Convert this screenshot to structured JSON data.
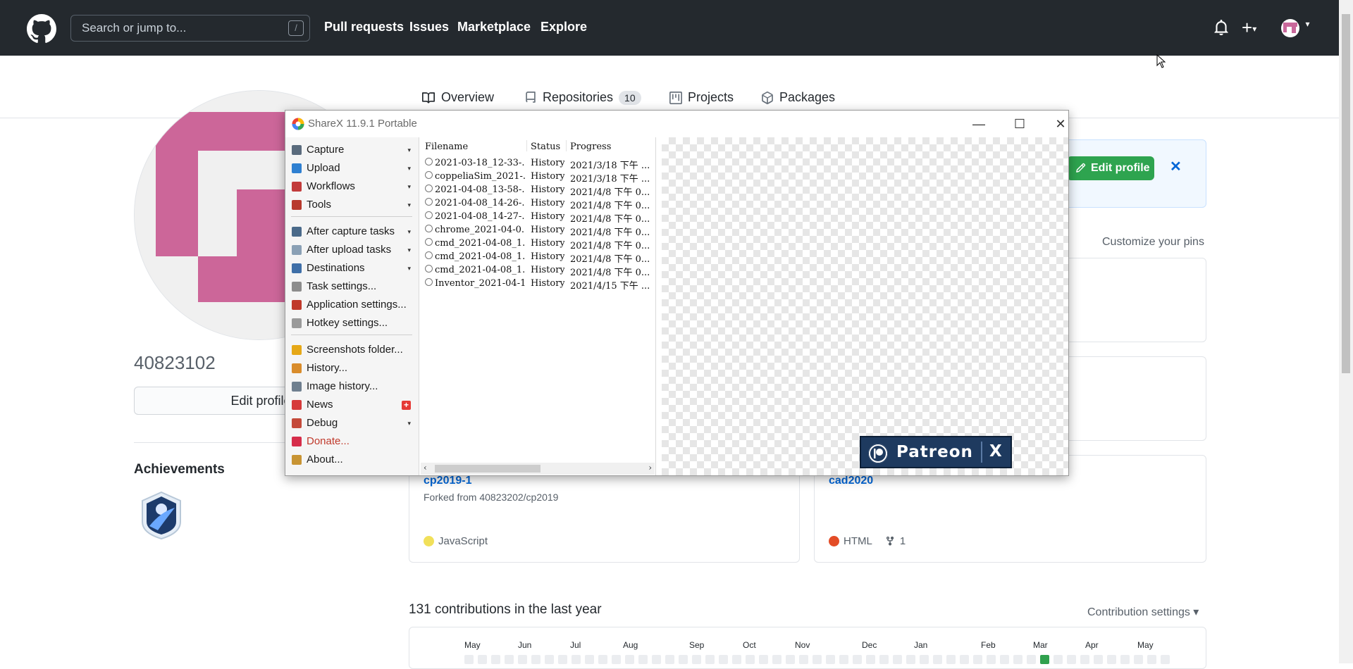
{
  "header": {
    "search_placeholder": "Search or jump to...",
    "search_kbd": "/",
    "nav": [
      "Pull requests",
      "Issues",
      "Marketplace",
      "Explore"
    ],
    "plus": "+"
  },
  "tabs": [
    {
      "label": "Overview"
    },
    {
      "label": "Repositories",
      "count": "10"
    },
    {
      "label": "Projects"
    },
    {
      "label": "Packages"
    }
  ],
  "profile": {
    "username": "40823102",
    "edit_button": "Edit profile",
    "achievements_title": "Achievements"
  },
  "notice": {
    "edit_button": "Edit profile",
    "close": "✕"
  },
  "pins": {
    "customize": "Customize your pins",
    "cards": [
      {
        "name": "cp2019-1",
        "forked": "Forked from 40823202/cp2019",
        "language": "JavaScript",
        "lang_color": "#f1e05a"
      },
      {
        "name": "cad2020",
        "language": "HTML",
        "lang_color": "#e34c26",
        "forks": "1"
      }
    ]
  },
  "contributions": {
    "title": "131 contributions in the last year",
    "settings": "Contribution settings ▾",
    "months": [
      "May",
      "Jun",
      "Jul",
      "Aug",
      "Sep",
      "Oct",
      "Nov",
      "Dec",
      "Jan",
      "Feb",
      "Mar",
      "Apr",
      "May"
    ],
    "active_color": "#30a14e"
  },
  "sharex": {
    "title": "ShareX 11.9.1 Portable",
    "controls": {
      "minimize": "—",
      "maximize": "☐",
      "close": "✕"
    },
    "menu": [
      {
        "label": "Capture",
        "submenu": true,
        "icon_color": "#5a6b7d"
      },
      {
        "label": "Upload",
        "submenu": true,
        "icon_color": "#2f80d1"
      },
      {
        "label": "Workflows",
        "submenu": true,
        "icon_color": "#c23b3b"
      },
      {
        "label": "Tools",
        "submenu": true,
        "icon_color": "#b83a2d"
      },
      {
        "label": "After capture tasks",
        "submenu": true,
        "icon_color": "#4a6a8a"
      },
      {
        "label": "After upload tasks",
        "submenu": true,
        "icon_color": "#8aa0b5"
      },
      {
        "label": "Destinations",
        "submenu": true,
        "icon_color": "#3f6fa8"
      },
      {
        "label": "Task settings...",
        "submenu": false,
        "icon_color": "#8c8c8c"
      },
      {
        "label": "Application settings...",
        "submenu": false,
        "icon_color": "#c0392b"
      },
      {
        "label": "Hotkey settings...",
        "submenu": false,
        "icon_color": "#9a9a9a"
      },
      {
        "label": "Screenshots folder...",
        "submenu": false,
        "icon_color": "#e6a817"
      },
      {
        "label": "History...",
        "submenu": false,
        "icon_color": "#d98c2b"
      },
      {
        "label": "Image history...",
        "submenu": false,
        "icon_color": "#6f7f8f"
      },
      {
        "label": "News",
        "submenu": false,
        "icon_color": "#d63a3a",
        "badge": "+"
      },
      {
        "label": "Debug",
        "submenu": true,
        "icon_color": "#c44a3a"
      },
      {
        "label": "Donate...",
        "submenu": false,
        "icon_color": "#d62d4a",
        "accent": "#c0392b"
      },
      {
        "label": "About...",
        "submenu": false,
        "icon_color": "#c89433"
      }
    ],
    "columns": [
      "Filename",
      "Status",
      "Progress"
    ],
    "rows": [
      {
        "filename": "2021-03-18_12-33-...",
        "status": "History",
        "progress": "2021/3/18 下午 ..."
      },
      {
        "filename": "coppeliaSim_2021-...",
        "status": "History",
        "progress": "2021/3/18 下午 ..."
      },
      {
        "filename": "2021-04-08_13-58-...",
        "status": "History",
        "progress": "2021/4/8 下午 0..."
      },
      {
        "filename": "2021-04-08_14-26-...",
        "status": "History",
        "progress": "2021/4/8 下午 0..."
      },
      {
        "filename": "2021-04-08_14-27-...",
        "status": "History",
        "progress": "2021/4/8 下午 0..."
      },
      {
        "filename": "chrome_2021-04-0...",
        "status": "History",
        "progress": "2021/4/8 下午 0..."
      },
      {
        "filename": "cmd_2021-04-08_1...",
        "status": "History",
        "progress": "2021/4/8 下午 0..."
      },
      {
        "filename": "cmd_2021-04-08_1...",
        "status": "History",
        "progress": "2021/4/8 下午 0..."
      },
      {
        "filename": "cmd_2021-04-08_1...",
        "status": "History",
        "progress": "2021/4/8 下午 0..."
      },
      {
        "filename": "Inventor_2021-04-1...",
        "status": "History",
        "progress": "2021/4/15 下午 ..."
      }
    ],
    "patreon": {
      "label": "Patreon",
      "close": "X"
    }
  }
}
